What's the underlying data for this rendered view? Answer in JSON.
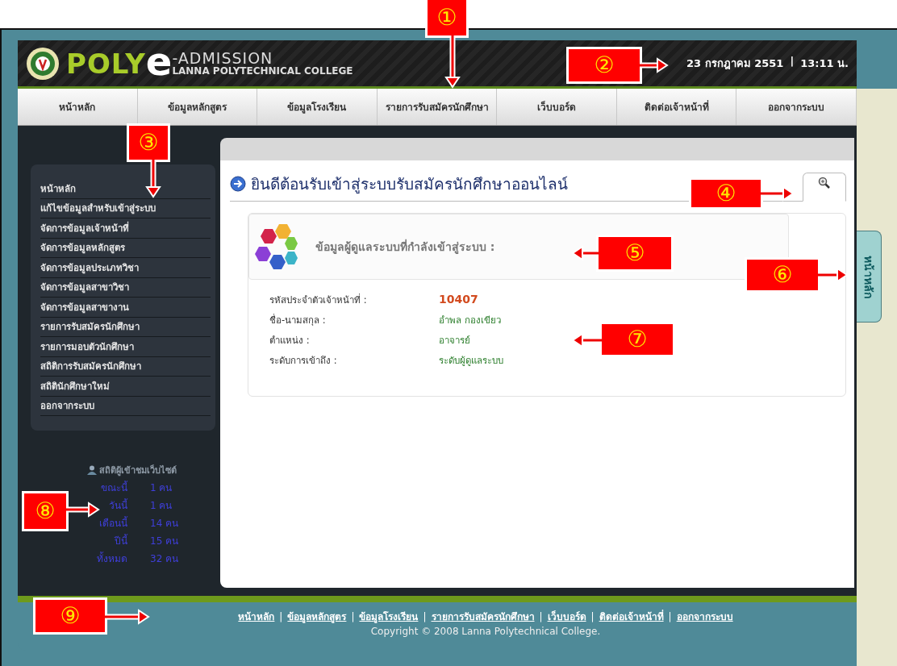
{
  "header": {
    "logo_poly": "POLY",
    "logo_e": "e",
    "logo_admission": "-ADMISSION",
    "logo_college": "LANNA POLYTECHNICAL COLLEGE",
    "date": "23 กรกฎาคม 2551",
    "separator": "|",
    "time": "13:11 น."
  },
  "nav": [
    "หน้าหลัก",
    "ข้อมูลหลักสูตร",
    "ข้อมูลโรงเรียน",
    "รายการรับสมัครนักศึกษา",
    "เว็บบอร์ด",
    "ติดต่อเจ้าหน้าที่",
    "ออกจากระบบ"
  ],
  "sidebar": {
    "menu": [
      "หน้าหลัก",
      "แก้ไขข้อมูลสำหรับเข้าสู่ระบบ",
      "จัดการข้อมูลเจ้าหน้าที่",
      "จัดการข้อมูลหลักสูตร",
      "จัดการข้อมูลประเภทวิชา",
      "จัดการข้อมูลสาขาวิชา",
      "จัดการข้อมูลสาขางาน",
      "รายการรับสมัครนักศึกษา",
      "รายการมอบตัวนักศึกษา",
      "สถิติการรับสมัครนักศึกษา",
      "สถิตินักศึกษาใหม่",
      "ออกจากระบบ"
    ],
    "stats": {
      "title": "สถิติผู้เข้าชมเว็บไซต์",
      "rows": [
        {
          "label": "ขณะนี้",
          "value": "1 คน"
        },
        {
          "label": "วันนี้",
          "value": "1 คน"
        },
        {
          "label": "เดือนนี้",
          "value": "14 คน"
        },
        {
          "label": "ปีนี้",
          "value": "15 คน"
        },
        {
          "label": "ทั้งหมด",
          "value": "32 คน"
        }
      ]
    }
  },
  "content": {
    "title": "ยินดีต้อนรับเข้าสู่ระบบรับสมัครนักศึกษาออนไลน์",
    "panel_title": "ข้อมูลผู้ดูแลระบบที่กำลังเข้าสู่ระบบ :",
    "fields": [
      {
        "label": "รหัสประจำตัวเจ้าหน้าที่ :",
        "value": "10407",
        "kind": "code"
      },
      {
        "label": "ชื่อ-นามสกุล :",
        "value": "อำพล  กองเขียว",
        "kind": "text"
      },
      {
        "label": "ตำแหน่ง :",
        "value": "อาจารย์",
        "kind": "text"
      },
      {
        "label": "ระดับการเข้าถึง :",
        "value": "ระดับผู้ดูแลระบบ",
        "kind": "text"
      }
    ]
  },
  "side_tab": "หน้าหลัก",
  "footer": {
    "links": [
      "หน้าหลัก",
      "ข้อมูลหลักสูตร",
      "ข้อมูลโรงเรียน",
      "รายการรับสมัครนักศึกษา",
      "เว็บบอร์ด",
      "ติดต่อเจ้าหน้าที่",
      "ออกจากระบบ"
    ],
    "separator": "|",
    "copyright": "Copyright © 2008 Lanna Polytechnical College."
  },
  "callouts": [
    {
      "number": "①",
      "kind": "down"
    },
    {
      "number": "②",
      "kind": "right"
    },
    {
      "number": "③",
      "kind": "down"
    },
    {
      "number": "④",
      "kind": "right"
    },
    {
      "number": "⑤",
      "kind": "left"
    },
    {
      "number": "⑥",
      "kind": "right"
    },
    {
      "number": "⑦",
      "kind": "left"
    },
    {
      "number": "⑧",
      "kind": "right"
    },
    {
      "number": "⑨",
      "kind": "right"
    }
  ]
}
